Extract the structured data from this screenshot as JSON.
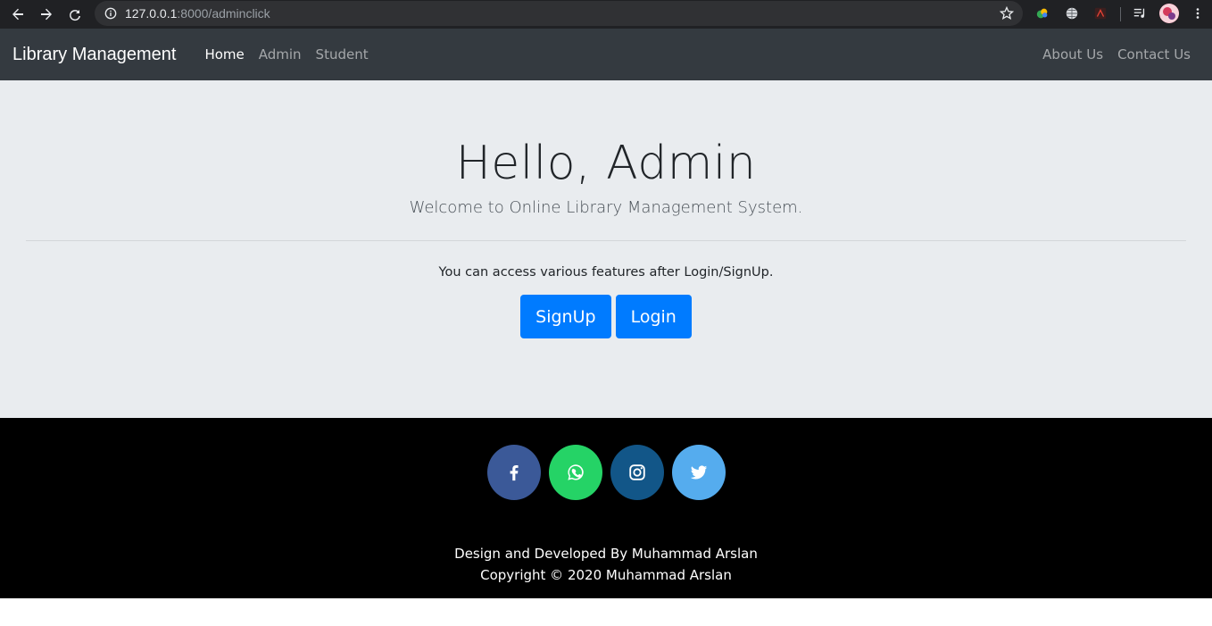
{
  "browser": {
    "url_host": "127.0.0.1",
    "url_path": ":8000/adminclick"
  },
  "navbar": {
    "brand": "Library Management",
    "links": [
      {
        "label": "Home"
      },
      {
        "label": "Admin"
      },
      {
        "label": "Student"
      }
    ],
    "right_links": [
      {
        "label": "About Us"
      },
      {
        "label": "Contact Us"
      }
    ]
  },
  "jumbotron": {
    "title": "Hello, Admin",
    "lead": "Welcome to Online Library Management System.",
    "note": "You can access various features after Login/SignUp.",
    "signup_label": "SignUp",
    "login_label": "Login"
  },
  "footer": {
    "social_icons": [
      "facebook-icon",
      "whatsapp-icon",
      "instagram-icon",
      "twitter-icon"
    ],
    "credit": "Design and Developed By Muhammad Arslan",
    "copyright": "Copyright © 2020 Muhammad Arslan"
  },
  "colors": {
    "navbar": "#343a40",
    "jumbotron": "#e9ecef",
    "primary": "#007bff",
    "facebook": "#3b5998",
    "whatsapp": "#25d366",
    "instagram": "#125688",
    "twitter": "#55acee"
  }
}
